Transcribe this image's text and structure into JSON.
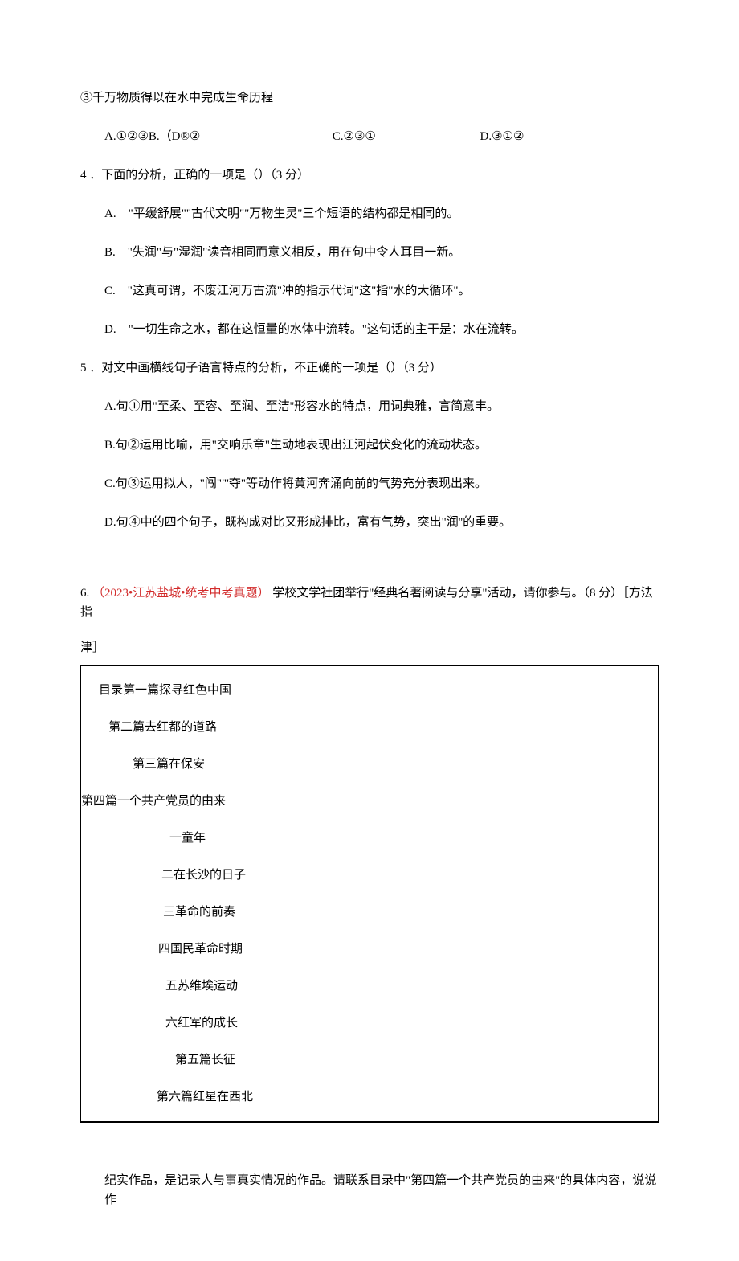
{
  "line_circ3": "③千万物质得以在水中完成生命历程",
  "q3_opts": {
    "a": "A.①②③B.（D®②",
    "c": "C.②③①",
    "d": "D.③①②"
  },
  "q4": {
    "stem": "4 ．下面的分析，正确的一项是（）（3 分）",
    "a": "A.　\"平缓舒展\"\"古代文明\"\"万物生灵\"三个短语的结构都是相同的。",
    "b": "B.　\"失润\"与\"湿润\"读音相同而意义相反，用在句中令人耳目一新。",
    "c": "C.　\"这真可谓，不废江河万古流\"冲的指示代词\"这\"指\"水的大循环\"。",
    "d": "D.　\"一切生命之水，都在这恒量的水体中流转。\"这句话的主干是：水在流转。"
  },
  "q5": {
    "stem": "5 ．对文中画横线句子语言特点的分析，不正确的一项是（）（3 分）",
    "a": "A.句①用\"至柔、至容、至润、至洁''形容水的特点，用词典雅，言简意丰。",
    "b": "B.句②运用比喻，用\"交响乐章\"生动地表现出江河起伏变化的流动状态。",
    "c": "C.句③运用拟人，\"闯\"\"'夺\"等动作将黄河奔涌向前的气势充分表现出来。",
    "d": "D.句④中的四个句子，既构成对比又形成排比，富有气势，突出\"润''的重要。"
  },
  "q6": {
    "prefix": "6.",
    "red": "（2023•江苏盐城•统考中考真题）",
    "tail": "学校文学社团举行\"经典名著阅读与分享\"活动，请你参与。（8 分）［方法指",
    "tail2": "津］"
  },
  "toc": {
    "p1_head": "目录第一篇探寻红色中国",
    "p2": "第二篇去红都的道路",
    "p3": "第三篇在保安",
    "p4": "第四篇一个共产党员的由来",
    "c1": "一童年",
    "c2": "二在长沙的日子",
    "c3": "三革命的前奏",
    "c4": "四国民革命时期",
    "c5": "五苏维埃运动",
    "c6": "六红军的成长",
    "p5": "第五篇长征",
    "p6": "第六篇红星在西北"
  },
  "final": "纪实作品，是记录人与事真实情况的作品。请联系目录中\"第四篇一个共产党员的由来\"的具体内容，说说作"
}
